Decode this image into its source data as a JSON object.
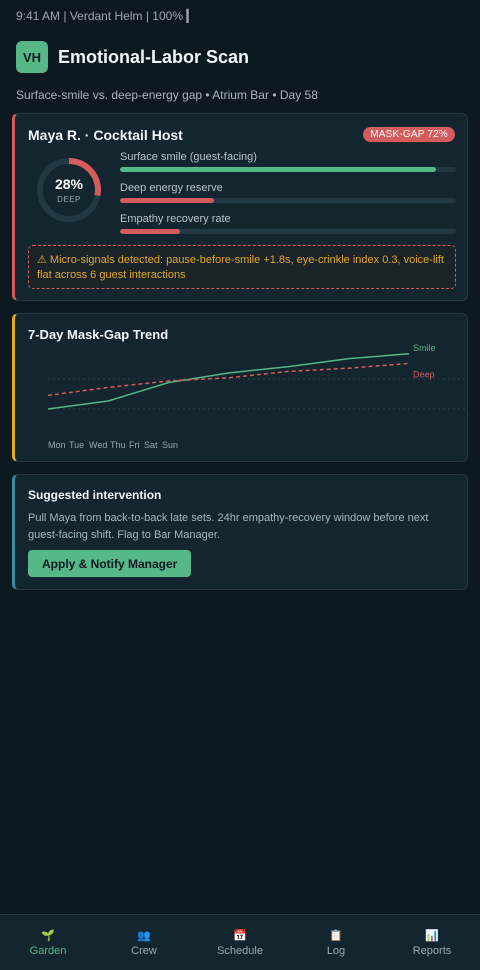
{
  "status_bar": {
    "text": "9:41 AM | Verdant Helm | 100% ▎"
  },
  "header": {
    "logo": "VH",
    "title": "Emotional-Labor Scan"
  },
  "subtitle": "Surface-smile vs. deep-energy gap • Atrium Bar • Day 58",
  "host_card": {
    "name": "Maya R. · Cocktail Host",
    "badge": "MASK-GAP 72%",
    "gauge": {
      "value_text": "28%",
      "label": "DEEP",
      "fraction": 0.28
    },
    "metrics": [
      {
        "label": "Surface smile (guest-facing)",
        "fraction": 0.94,
        "color": "#56b787"
      },
      {
        "label": "Deep energy reserve",
        "fraction": 0.28,
        "color": "#d45c5c"
      },
      {
        "label": "Empathy recovery rate",
        "fraction": 0.18,
        "color": "#d45c5c"
      }
    ],
    "alert": "⚠ Micro-signals detected: pause-before-smile +1.8s, eye-crinkle index 0.3, voice-lift flat across 6 guest interactions"
  },
  "trend_card": {
    "title": "7-Day Mask-Gap Trend",
    "chart_data": {
      "type": "line",
      "categories": [
        "Mon",
        "Tue",
        "Wed",
        "Thu",
        "Fri",
        "Sat",
        "Sun"
      ],
      "series": [
        {
          "name": "Smile",
          "values": [
            0.25,
            0.35,
            0.58,
            0.7,
            0.78,
            0.88,
            0.94
          ],
          "color": "#56b787",
          "dashed": false
        },
        {
          "name": "Deep",
          "values": [
            0.42,
            0.52,
            0.6,
            0.64,
            0.72,
            0.76,
            0.82
          ],
          "color": "#d45c5c",
          "dashed": true
        }
      ],
      "ylim": [
        0,
        1
      ]
    }
  },
  "intervention_card": {
    "title": "Suggested intervention",
    "text": "Pull Maya from back-to-back late sets. 24hr empathy-recovery window before next guest-facing shift. Flag to Bar Manager.",
    "button_label": "Apply & Notify Manager"
  },
  "tabs": [
    {
      "label": "Garden",
      "icon": "sprout-icon",
      "glyph": "🌱",
      "active": true
    },
    {
      "label": "Crew",
      "icon": "people-icon",
      "glyph": "👥",
      "active": false
    },
    {
      "label": "Schedule",
      "icon": "calendar-icon",
      "glyph": "📅",
      "active": false
    },
    {
      "label": "Log",
      "icon": "clipboard-icon",
      "glyph": "📋",
      "active": false
    },
    {
      "label": "Reports",
      "icon": "bar-chart-icon",
      "glyph": "📊",
      "active": false
    }
  ]
}
